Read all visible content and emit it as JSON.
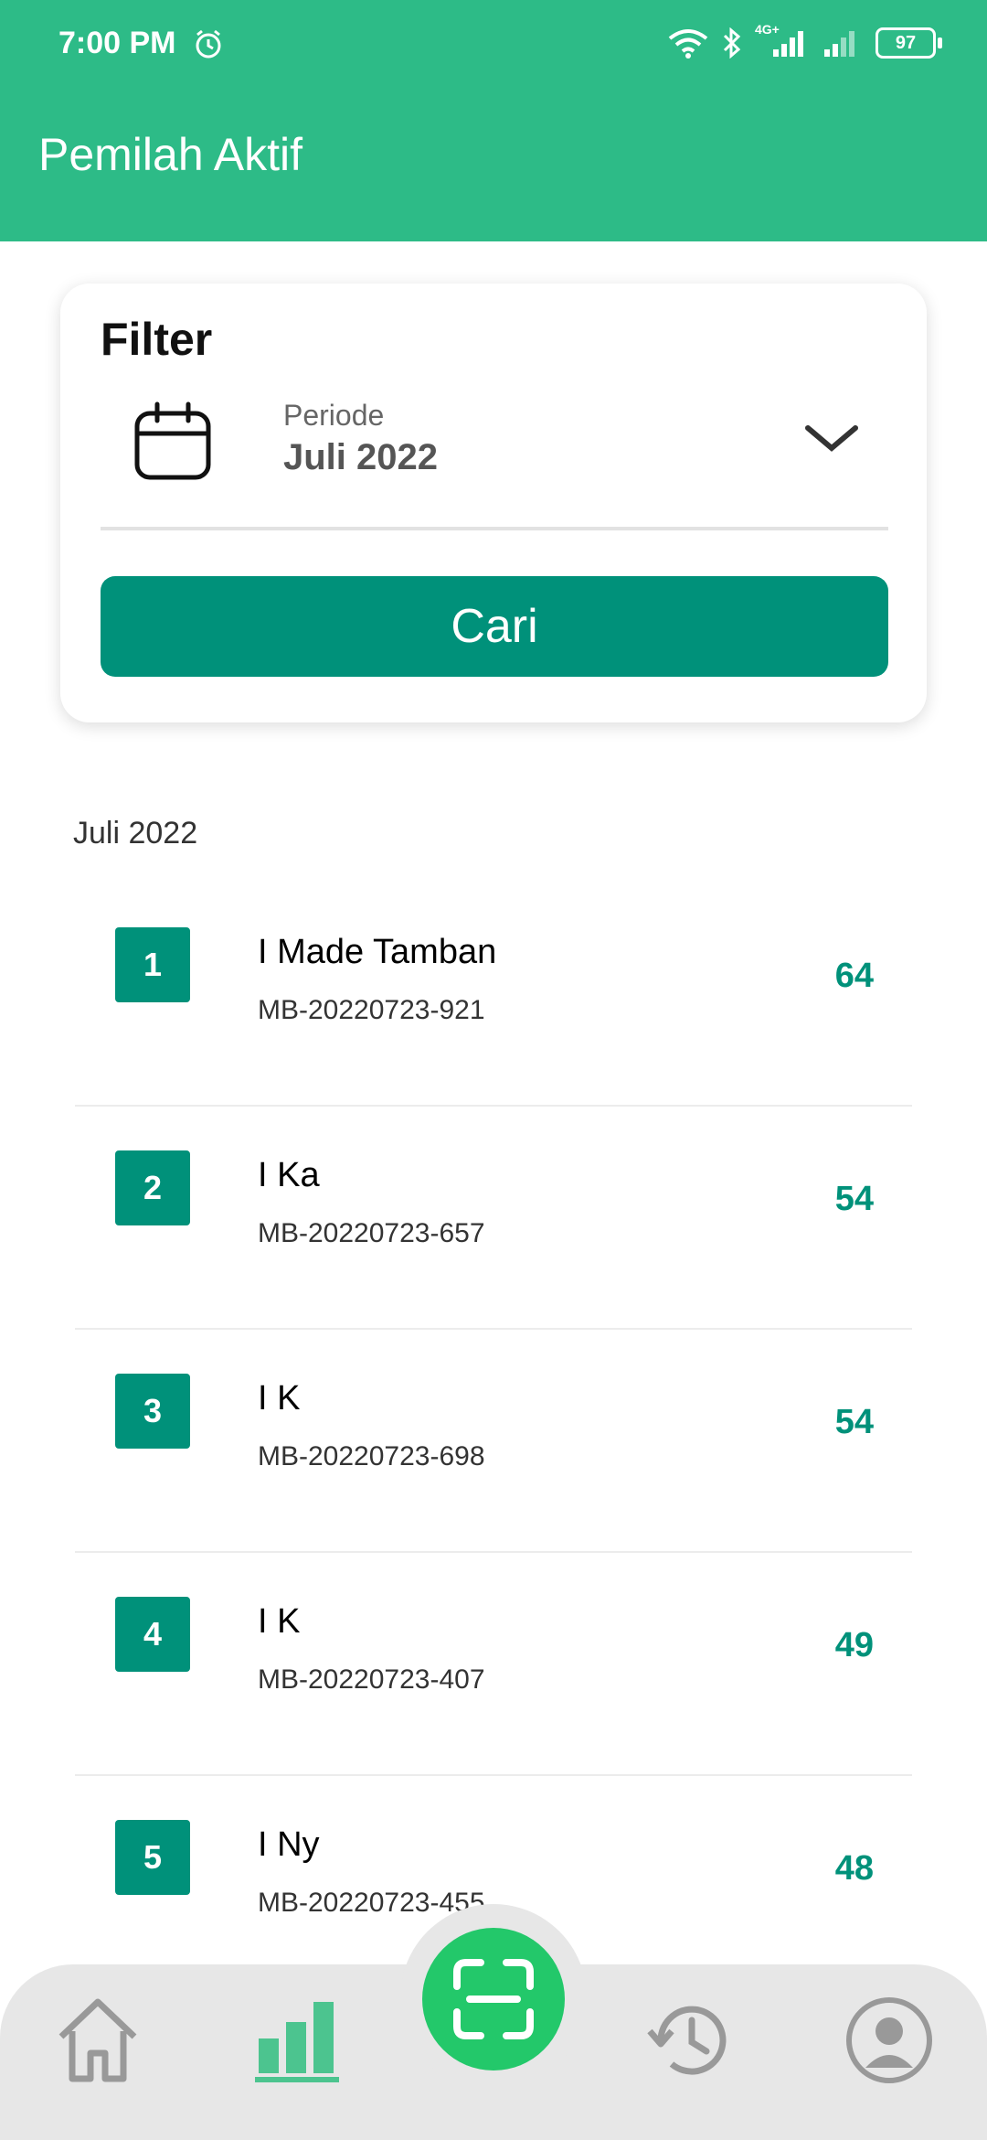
{
  "status_bar": {
    "time": "7:00 PM",
    "network": "4G+",
    "battery": "97",
    "icons": [
      "alarm-icon",
      "wifi-icon",
      "bluetooth-icon",
      "signal-icon",
      "signal-icon-2",
      "battery-icon"
    ]
  },
  "header": {
    "title": "Pemilah Aktif",
    "color": "#2dbb87"
  },
  "filter": {
    "title": "Filter",
    "period_caption": "Periode",
    "period_value": "Juli 2022",
    "search_label": "Cari",
    "accent": "#00917a"
  },
  "section": {
    "title": "Juli 2022"
  },
  "rankings": [
    {
      "rank": "1",
      "name": "I Made Tamban",
      "code": "MB-20220723-921",
      "score": "64"
    },
    {
      "rank": "2",
      "name": "I Ka",
      "code": "MB-20220723-657",
      "score": "54"
    },
    {
      "rank": "3",
      "name": "I K",
      "code": "MB-20220723-698",
      "score": "54"
    },
    {
      "rank": "4",
      "name": "I K",
      "code": "MB-20220723-407",
      "score": "49"
    },
    {
      "rank": "5",
      "name": "I Ny",
      "code": "MB-20220723-455",
      "score": "48"
    }
  ],
  "bottom_nav": {
    "items": [
      "home-icon",
      "leaderboard-icon",
      "scan-icon",
      "history-icon",
      "profile-icon"
    ],
    "active": "leaderboard-icon",
    "scan_color": "#23c86a"
  }
}
